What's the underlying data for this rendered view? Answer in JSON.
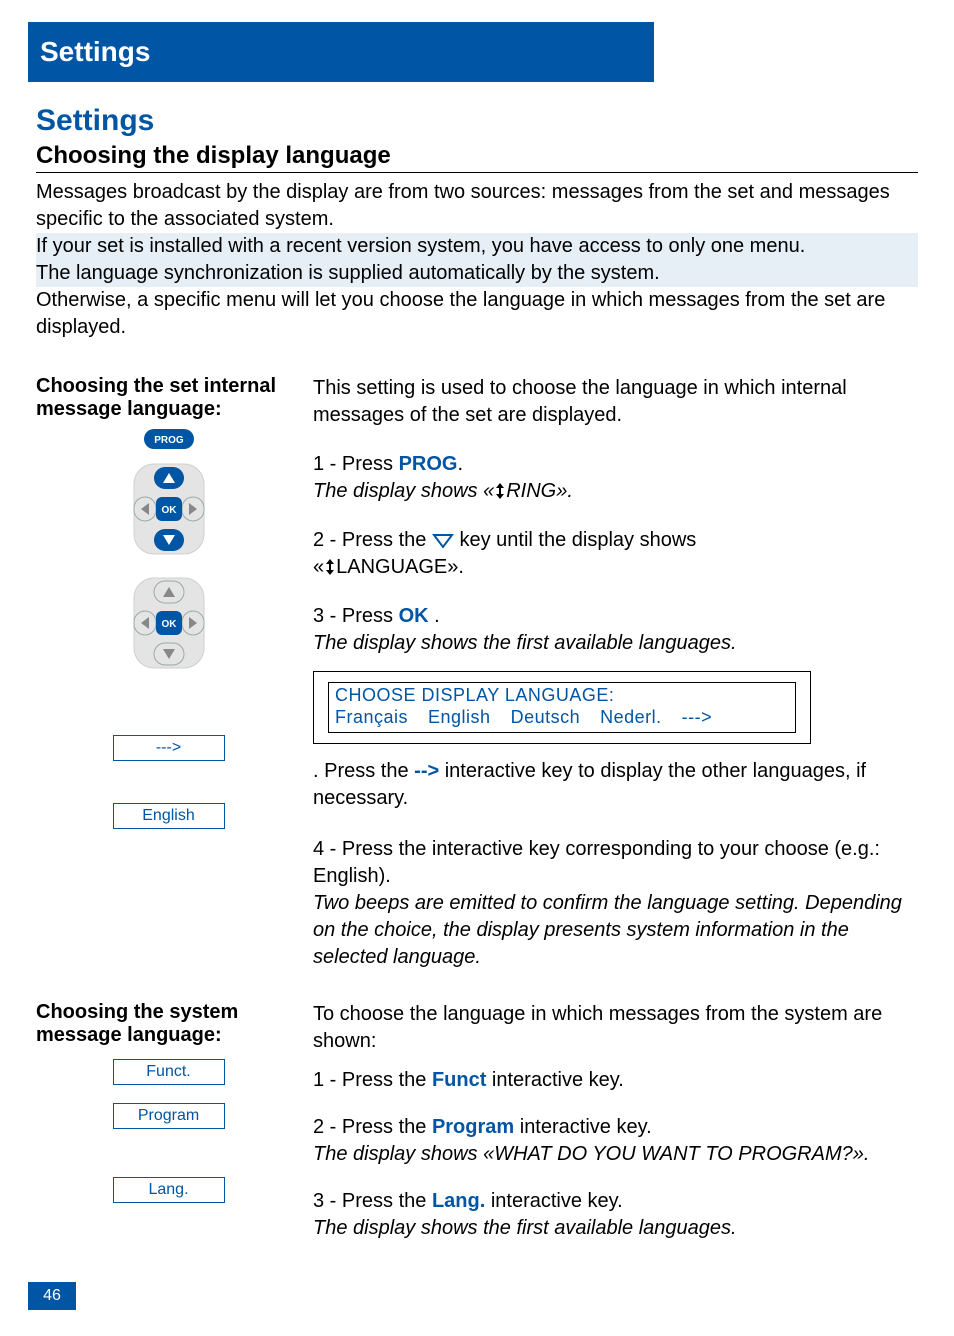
{
  "header": {
    "title": "Settings"
  },
  "section": {
    "h1": "Settings",
    "h2": "Choosing the display language",
    "intro1": "Messages broadcast by the display are from two sources: messages from the set and messages specific to the associated system.",
    "intro_hi1": "If your set is installed with a recent version system, you have access to only one menu.",
    "intro_hi2": "The language synchronization is supplied automatically by the system.",
    "intro2": "Otherwise, a specific menu will let you choose the language in which messages from the set are displayed."
  },
  "block1": {
    "left_title": "Choosing the set internal message language:",
    "right_intro": "This setting is used to choose the language in which internal messages of the set are displayed.",
    "step1_a": "1 - Press ",
    "step1_key": "PROG",
    "step1_b": ".",
    "step1_note_a": "The display shows «",
    "step1_note_b": "RING».",
    "step2_a": "2 - Press the ",
    "step2_b": " key until the display shows",
    "step2_c_a": "«",
    "step2_c_b": "LANGUAGE».",
    "step3_a": "3 - Press ",
    "step3_key": "OK",
    "step3_b": " .",
    "step3_note": "The display shows the first available languages.",
    "lcd_title": "CHOOSE DISPLAY LANGUAGE:",
    "lcd_options": [
      "Français",
      "English",
      "Deutsch",
      "Nederl.",
      "--->"
    ],
    "next_key_label": "--->",
    "next_key_text_a": ". Press the ",
    "next_key_text_key": "-->",
    "next_key_text_b": " interactive key to display the other languages, if necessary.",
    "english_key_label": "English",
    "step4_a": "4 - Press the interactive key corresponding to your choose (e.g.: English).",
    "step4_note": "Two beeps are emitted to confirm the language setting. Depending on the choice, the display presents system information in the selected language."
  },
  "block2": {
    "left_title": "Choosing the system message language:",
    "right_intro": "To choose the language in which messages from the system are shown:",
    "funct_label": "Funct.",
    "step1_a": "1 - Press the ",
    "step1_key": "Funct",
    "step1_b": " interactive key.",
    "program_label": "Program",
    "step2_a": "2 - Press the ",
    "step2_key": "Program",
    "step2_b": " interactive key.",
    "step2_note": "The display shows «WHAT DO YOU WANT TO PROGRAM?».",
    "lang_label": "Lang.",
    "step3_a": "3 - Press the ",
    "step3_key": "Lang.",
    "step3_b": " interactive key.",
    "step3_note": "The display shows the first available languages."
  },
  "footer": {
    "page": "46"
  }
}
